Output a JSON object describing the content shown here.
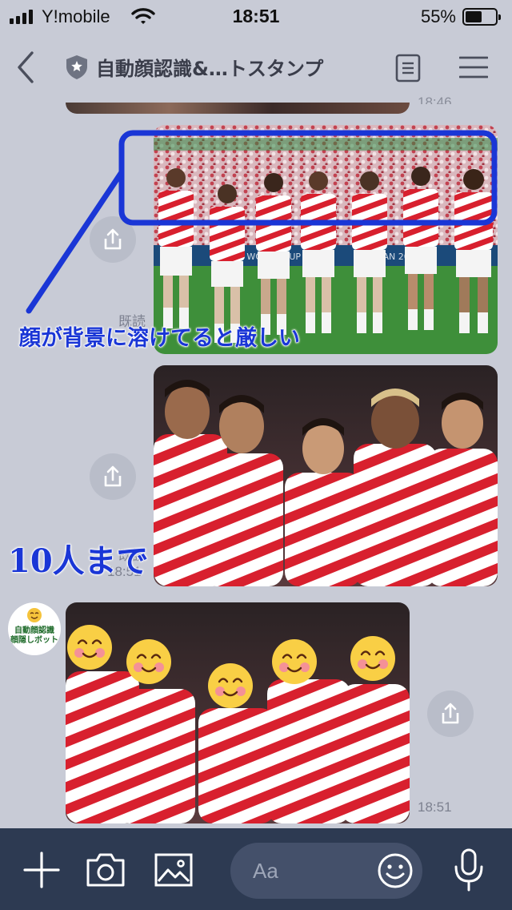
{
  "status_bar": {
    "carrier": "Y!mobile",
    "time": "18:51",
    "battery_percent_text": "55%",
    "battery_level": 0.55
  },
  "header": {
    "title": "自動顔認識&…トスタンプ",
    "icons": [
      "chevron-left-icon",
      "shield-star-icon",
      "notes-icon",
      "menu-icon"
    ]
  },
  "messages": [
    {
      "kind": "image",
      "side": "left",
      "status_partial": "18:46"
    },
    {
      "kind": "image",
      "side": "right",
      "read": "既読",
      "annotation": "顔が背景に溶けてると厳しい"
    },
    {
      "kind": "image",
      "side": "right",
      "read": "既読",
      "time": "18:51",
      "annotation": "10人まで"
    },
    {
      "kind": "image",
      "side": "left",
      "sender_avatar_lines": [
        "自動顔認識",
        "顔隠しボット"
      ],
      "time": "18:51"
    }
  ],
  "input_bar": {
    "placeholder": "Aa",
    "icons": [
      "plus-icon",
      "camera-icon",
      "image-icon",
      "emoji-icon",
      "microphone-icon"
    ]
  },
  "colors": {
    "chat_background": "#c8cbd6",
    "bottom_bar": "#2d3a52",
    "annotation_blue": "#1a36d6",
    "jersey_red": "#d8202e"
  }
}
